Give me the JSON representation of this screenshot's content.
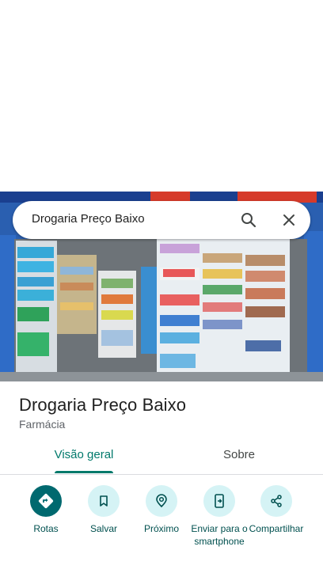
{
  "search": {
    "text": "Drogaria Preço Baixo"
  },
  "place": {
    "name": "Drogaria Preço Baixo",
    "category": "Farmácia"
  },
  "tabs": [
    {
      "label": "Visão geral",
      "selected": true
    },
    {
      "label": "Sobre",
      "selected": false
    }
  ],
  "actions": [
    {
      "label": "Rotas",
      "icon": "directions-icon"
    },
    {
      "label": "Salvar",
      "icon": "bookmark-icon"
    },
    {
      "label": "Próximo",
      "icon": "nearby-icon"
    },
    {
      "label": "Enviar para o smartphone",
      "icon": "send-to-phone-icon"
    },
    {
      "label": "Compartilhar",
      "icon": "share-icon"
    }
  ],
  "colors": {
    "accent": "#00796b",
    "action_bg": "#d5f3f5",
    "primary_action": "#00696f"
  }
}
